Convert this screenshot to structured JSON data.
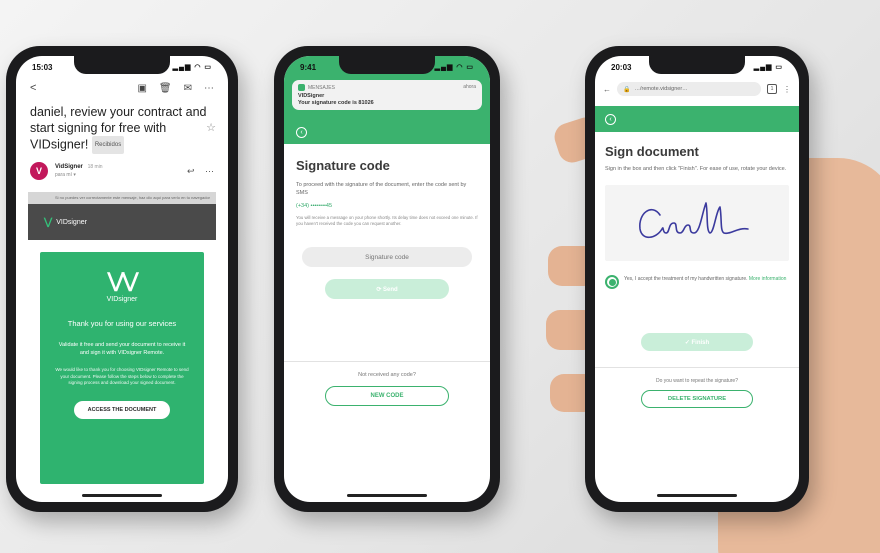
{
  "phone1": {
    "status_time": "15:03",
    "status_icons": "▂▄▆ ◠ ▭",
    "toolbar": {
      "back": "<",
      "archive": "▣",
      "delete": "🗑",
      "mail": "✉",
      "more": "⋯"
    },
    "subject": "daniel, review your contract and start signing for free with VIDsigner!",
    "inbox_tag": "Recibidos",
    "star": "☆",
    "sender": {
      "avatar_letter": "V",
      "avatar_color": "#c2185b",
      "name": "VidSigner",
      "time": "18 min",
      "to": "para mí ▾",
      "reply": "↩",
      "more": "⋯"
    },
    "banner_text": "Si no puedes ver correctamente este mensaje, haz clic aquí para verlo en tu navegador",
    "brandbar": {
      "logo": "⋁",
      "name": "VIDsigner"
    },
    "card": {
      "logo": "⋁⋁",
      "name": "VIDsigner",
      "thanks": "Thank you for using our services",
      "text1": "Validate it free and send your document to receive it and sign it with VIDsigner Remote.",
      "text2": "We would like to thank you for choosing VIDsigner Remote to send your document. Please follow the steps below to complete the signing process and download your signed document.",
      "button": "ACCESS THE DOCUMENT"
    }
  },
  "phone2": {
    "status_time": "9:41",
    "status_icons": "▂▄▆ ◠ ▭",
    "notification": {
      "app": "MENSAJES",
      "when": "ahora",
      "title": "VIDSigner",
      "body": "Your signature code is 81026"
    },
    "back_icon": "‹",
    "title": "Signature code",
    "intro": "To proceed with the signature of the document, enter the code sent by SMS",
    "phone": "(+34) ••••••••45",
    "note": "You will receive a message on your phone shortly. Its delay time does not exceed one minute. If you haven't received the code you can request another.",
    "input_placeholder": "Signature code",
    "send_button": "⟳ Send",
    "not_received": "Not received any code?",
    "new_code_button": "NEW CODE"
  },
  "phone3": {
    "status_time": "20:03",
    "status_icons": "▂▄▆ ▭",
    "browser": {
      "back": "←",
      "lock": "🔒",
      "url": "…/remote.vidsigner…",
      "tabs": "1",
      "menu": "⋮"
    },
    "strip_icon": "‹",
    "title": "Sign document",
    "intro": "Sign in the box and then click \"Finish\". For ease of use, rotate your device.",
    "accept_text": "Yes, I accept the treatment of my handwritten signature.",
    "accept_link": "More information",
    "finish_button": "✓ Finish",
    "repeat_question": "Do you want to repeat the signature?",
    "delete_button": "DELETE SIGNATURE",
    "signature_ink_color": "#3b3a9e"
  },
  "colors": {
    "brand_green": "#3bb26e",
    "card_green": "#2fb36f",
    "dark_bar": "#4a4a4a"
  }
}
